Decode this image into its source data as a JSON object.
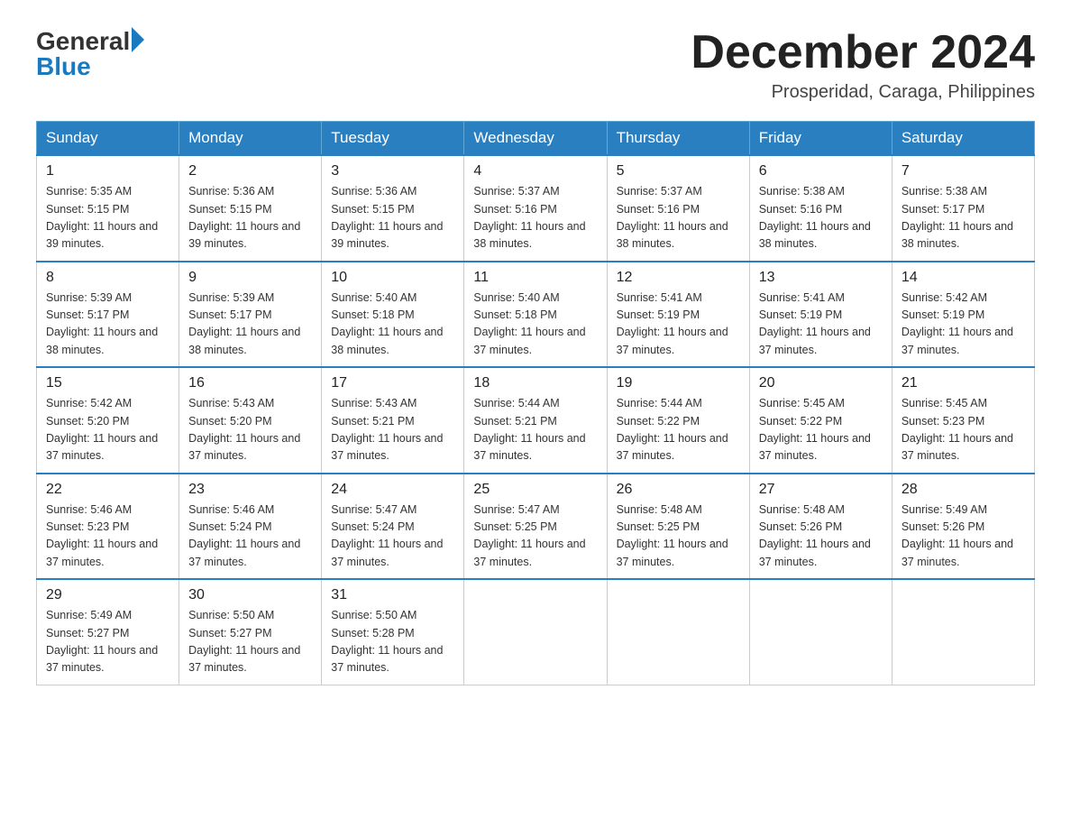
{
  "logo": {
    "general": "General",
    "blue": "Blue"
  },
  "header": {
    "month_year": "December 2024",
    "location": "Prosperidad, Caraga, Philippines"
  },
  "days_of_week": [
    "Sunday",
    "Monday",
    "Tuesday",
    "Wednesday",
    "Thursday",
    "Friday",
    "Saturday"
  ],
  "weeks": [
    [
      {
        "day": "1",
        "sunrise": "5:35 AM",
        "sunset": "5:15 PM",
        "daylight": "11 hours and 39 minutes."
      },
      {
        "day": "2",
        "sunrise": "5:36 AM",
        "sunset": "5:15 PM",
        "daylight": "11 hours and 39 minutes."
      },
      {
        "day": "3",
        "sunrise": "5:36 AM",
        "sunset": "5:15 PM",
        "daylight": "11 hours and 39 minutes."
      },
      {
        "day": "4",
        "sunrise": "5:37 AM",
        "sunset": "5:16 PM",
        "daylight": "11 hours and 38 minutes."
      },
      {
        "day": "5",
        "sunrise": "5:37 AM",
        "sunset": "5:16 PM",
        "daylight": "11 hours and 38 minutes."
      },
      {
        "day": "6",
        "sunrise": "5:38 AM",
        "sunset": "5:16 PM",
        "daylight": "11 hours and 38 minutes."
      },
      {
        "day": "7",
        "sunrise": "5:38 AM",
        "sunset": "5:17 PM",
        "daylight": "11 hours and 38 minutes."
      }
    ],
    [
      {
        "day": "8",
        "sunrise": "5:39 AM",
        "sunset": "5:17 PM",
        "daylight": "11 hours and 38 minutes."
      },
      {
        "day": "9",
        "sunrise": "5:39 AM",
        "sunset": "5:17 PM",
        "daylight": "11 hours and 38 minutes."
      },
      {
        "day": "10",
        "sunrise": "5:40 AM",
        "sunset": "5:18 PM",
        "daylight": "11 hours and 38 minutes."
      },
      {
        "day": "11",
        "sunrise": "5:40 AM",
        "sunset": "5:18 PM",
        "daylight": "11 hours and 37 minutes."
      },
      {
        "day": "12",
        "sunrise": "5:41 AM",
        "sunset": "5:19 PM",
        "daylight": "11 hours and 37 minutes."
      },
      {
        "day": "13",
        "sunrise": "5:41 AM",
        "sunset": "5:19 PM",
        "daylight": "11 hours and 37 minutes."
      },
      {
        "day": "14",
        "sunrise": "5:42 AM",
        "sunset": "5:19 PM",
        "daylight": "11 hours and 37 minutes."
      }
    ],
    [
      {
        "day": "15",
        "sunrise": "5:42 AM",
        "sunset": "5:20 PM",
        "daylight": "11 hours and 37 minutes."
      },
      {
        "day": "16",
        "sunrise": "5:43 AM",
        "sunset": "5:20 PM",
        "daylight": "11 hours and 37 minutes."
      },
      {
        "day": "17",
        "sunrise": "5:43 AM",
        "sunset": "5:21 PM",
        "daylight": "11 hours and 37 minutes."
      },
      {
        "day": "18",
        "sunrise": "5:44 AM",
        "sunset": "5:21 PM",
        "daylight": "11 hours and 37 minutes."
      },
      {
        "day": "19",
        "sunrise": "5:44 AM",
        "sunset": "5:22 PM",
        "daylight": "11 hours and 37 minutes."
      },
      {
        "day": "20",
        "sunrise": "5:45 AM",
        "sunset": "5:22 PM",
        "daylight": "11 hours and 37 minutes."
      },
      {
        "day": "21",
        "sunrise": "5:45 AM",
        "sunset": "5:23 PM",
        "daylight": "11 hours and 37 minutes."
      }
    ],
    [
      {
        "day": "22",
        "sunrise": "5:46 AM",
        "sunset": "5:23 PM",
        "daylight": "11 hours and 37 minutes."
      },
      {
        "day": "23",
        "sunrise": "5:46 AM",
        "sunset": "5:24 PM",
        "daylight": "11 hours and 37 minutes."
      },
      {
        "day": "24",
        "sunrise": "5:47 AM",
        "sunset": "5:24 PM",
        "daylight": "11 hours and 37 minutes."
      },
      {
        "day": "25",
        "sunrise": "5:47 AM",
        "sunset": "5:25 PM",
        "daylight": "11 hours and 37 minutes."
      },
      {
        "day": "26",
        "sunrise": "5:48 AM",
        "sunset": "5:25 PM",
        "daylight": "11 hours and 37 minutes."
      },
      {
        "day": "27",
        "sunrise": "5:48 AM",
        "sunset": "5:26 PM",
        "daylight": "11 hours and 37 minutes."
      },
      {
        "day": "28",
        "sunrise": "5:49 AM",
        "sunset": "5:26 PM",
        "daylight": "11 hours and 37 minutes."
      }
    ],
    [
      {
        "day": "29",
        "sunrise": "5:49 AM",
        "sunset": "5:27 PM",
        "daylight": "11 hours and 37 minutes."
      },
      {
        "day": "30",
        "sunrise": "5:50 AM",
        "sunset": "5:27 PM",
        "daylight": "11 hours and 37 minutes."
      },
      {
        "day": "31",
        "sunrise": "5:50 AM",
        "sunset": "5:28 PM",
        "daylight": "11 hours and 37 minutes."
      },
      null,
      null,
      null,
      null
    ]
  ],
  "labels": {
    "sunrise": "Sunrise:",
    "sunset": "Sunset:",
    "daylight": "Daylight:"
  }
}
